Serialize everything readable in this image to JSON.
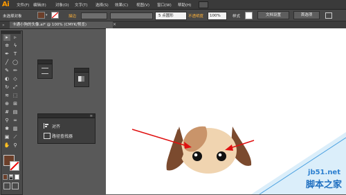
{
  "app": {
    "logo": "Ai"
  },
  "menubar": {
    "items": [
      "文件(F)",
      "编辑(E)",
      "对象(O)",
      "文字(T)",
      "选择(S)",
      "效果(C)",
      "视图(V)",
      "窗口(W)",
      "帮助(H)"
    ]
  },
  "controlbar": {
    "selection_status": "未选择对象",
    "stroke_label": "描边",
    "brush_value": "5 点圆形",
    "opacity_label": "不透明度",
    "opacity_value": "100%",
    "style_label": "样式",
    "doc_setup_label": "文档设置",
    "preferences_label": "首选项"
  },
  "document_tab": {
    "title": "卡通小狗的头像.ai* @ 100% (CMYK/预览)"
  },
  "panels": {
    "align_label": "对齐",
    "pathfinder_label": "路径查找器"
  },
  "colors": {
    "fill": "#6b3f2a",
    "accent": "#ff9a00",
    "dog_face": "#f0d4b0",
    "dog_ear": "#7b4a2e",
    "arrow": "#e01010"
  },
  "watermark": {
    "site": "jb51.net",
    "name": "脚本之家"
  }
}
